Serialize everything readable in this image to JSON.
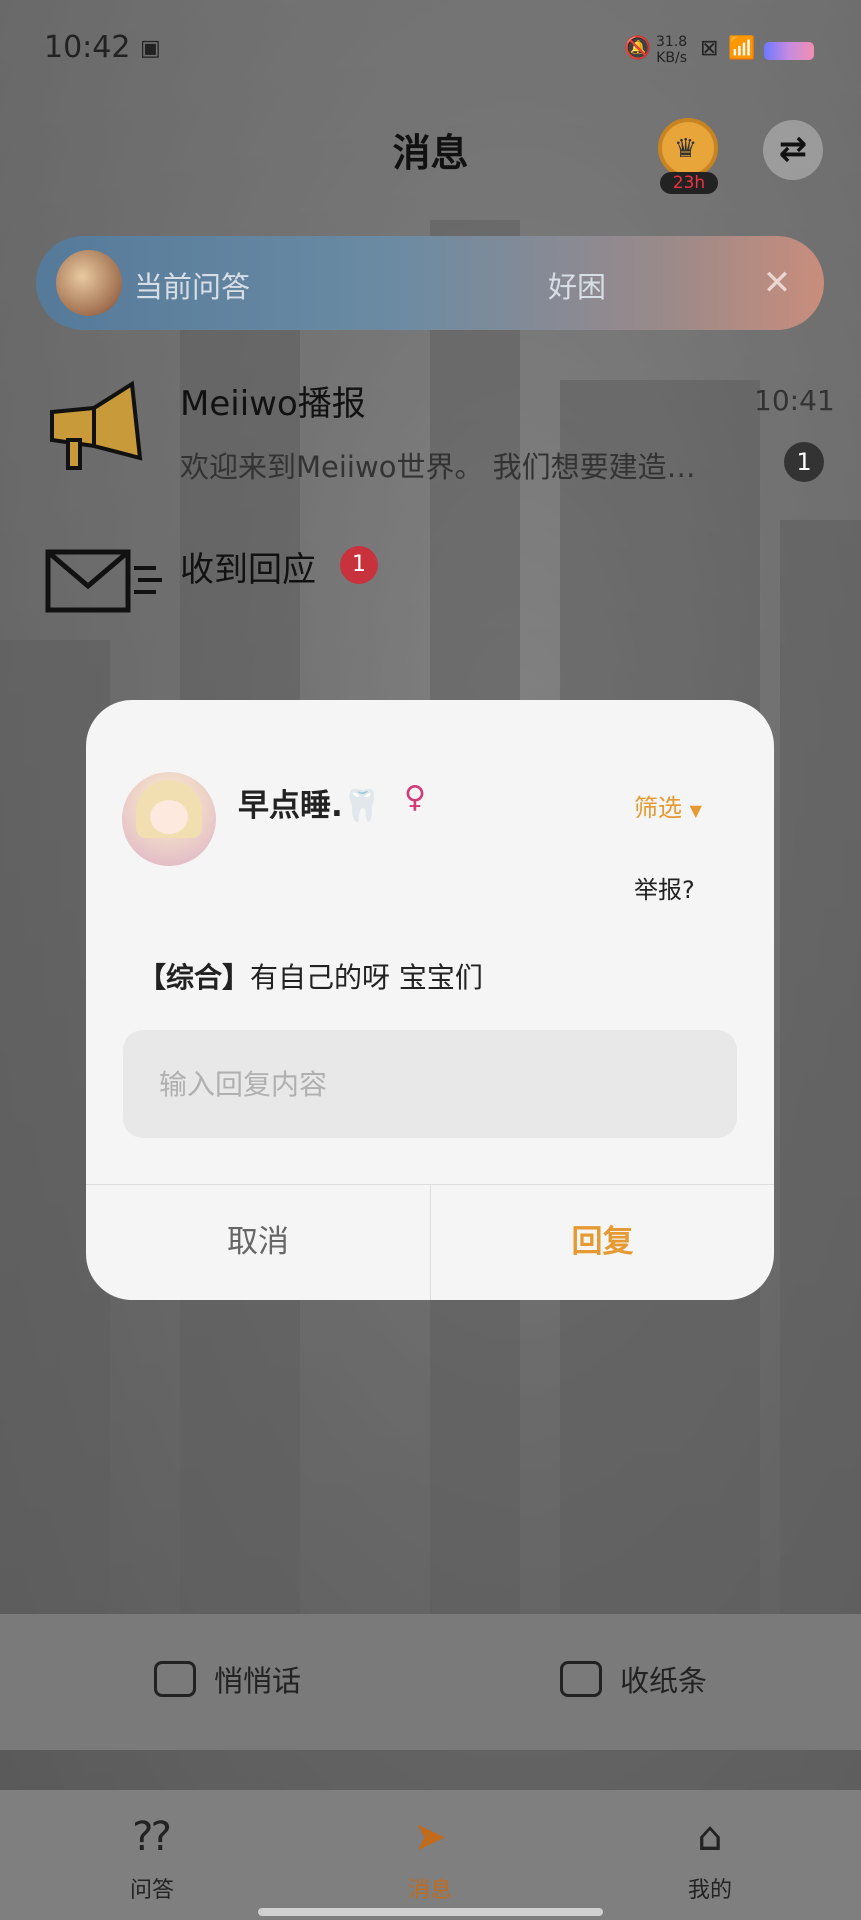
{
  "status_bar": {
    "time": "10:42",
    "network_speed": "31.8",
    "network_unit": "KB/s",
    "icons": [
      "bell-off-icon",
      "close-box-icon",
      "wifi-icon",
      "battery-icon"
    ]
  },
  "header": {
    "title": "消息",
    "crown_timer": "23h"
  },
  "current_qa": {
    "label": "当前问答",
    "text": "好困"
  },
  "messages": [
    {
      "title": "Meiiwo播报",
      "preview": "欢迎来到Meiiwo世界。 我们想要建造…",
      "time": "10:41",
      "unread": "1"
    },
    {
      "title": "收到回应",
      "unread": "1"
    }
  ],
  "dialog": {
    "username": "早点睡.🦷",
    "gender_symbol": "♀",
    "filter_label": "筛选",
    "report_label": "举报?",
    "message_tag": "【综合】",
    "message_text": "有自己的呀 宝宝们",
    "input_placeholder": "输入回复内容",
    "cancel_label": "取消",
    "reply_label": "回复"
  },
  "actions": {
    "whisper_label": "悄悄话",
    "collect_label": "收纸条"
  },
  "nav": {
    "items": [
      {
        "label": "问答",
        "icon": "qa-bubble-icon"
      },
      {
        "label": "消息",
        "icon": "paper-plane-icon"
      },
      {
        "label": "我的",
        "icon": "home-icon"
      }
    ],
    "active_color": "#c26b1c"
  },
  "colors": {
    "accent": "#e59a33",
    "badge_red": "#c8323c",
    "gender_female": "#d23b7a"
  }
}
